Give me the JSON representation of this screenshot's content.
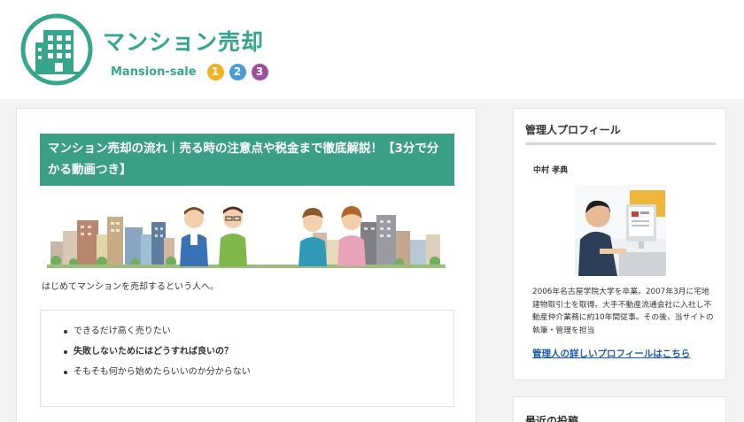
{
  "header": {
    "site_title": "マンション売却",
    "subtitle": "Mansion-sale",
    "badges": [
      {
        "label": "1",
        "color": "#f2b125"
      },
      {
        "label": "2",
        "color": "#4a9bd6"
      },
      {
        "label": "3",
        "color": "#9b4f9d"
      }
    ],
    "brand_color": "#35a58b"
  },
  "article": {
    "title": "マンション売却の流れ｜売る時の注意点や税金まで徹底解説！【3分で分かる動画つき】",
    "intro": "はじめてマンションを売却するという人へ。",
    "checklist": [
      "できるだけ高く売りたい",
      "失敗しないためにはどうすれば良いの？",
      "そもそも何から始めたらいいのか分からない"
    ]
  },
  "sidebar": {
    "profile_heading": "管理人プロフィール",
    "name": "中村 孝典",
    "bio": "2006年名古屋学院大学を卒業。2007年3月に宅地建物取引士を取得。大手不動産流通会社に入社し不動産仲介業務に約10年間従事。その後、当サイトの執筆・管理を担当",
    "profile_link": "管理人の詳しいプロフィールはこちら",
    "recent_heading": "最近の投稿"
  }
}
